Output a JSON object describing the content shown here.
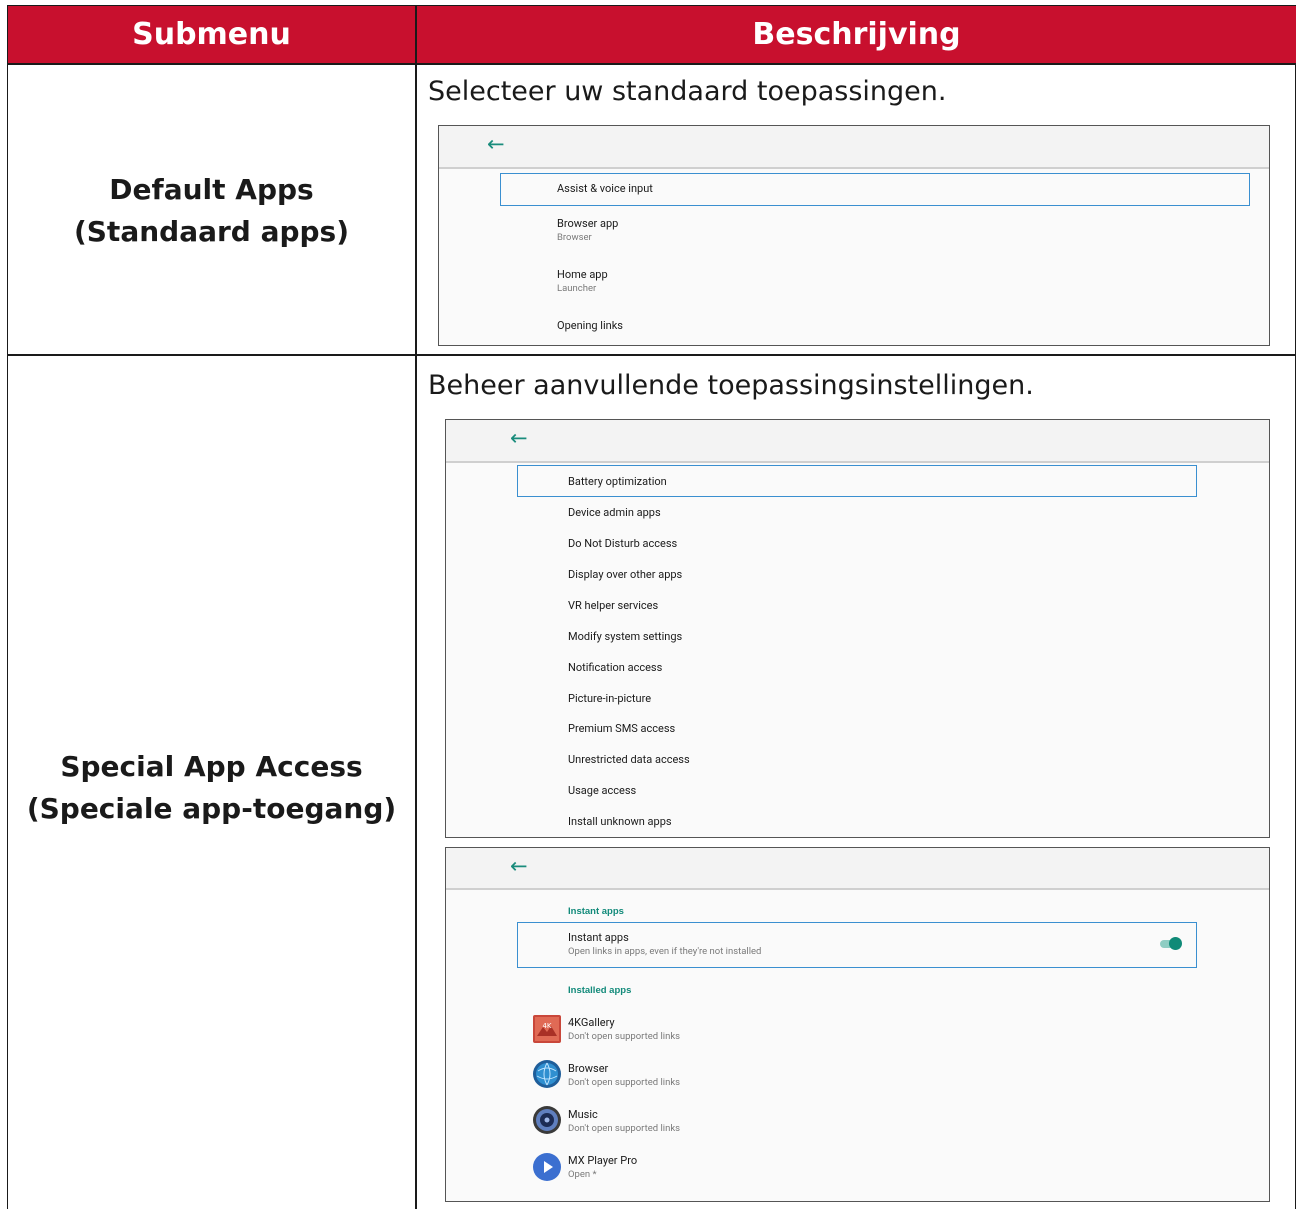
{
  "table": {
    "header": {
      "col1": "Submenu",
      "col2": "Beschrijving"
    },
    "rows": [
      {
        "label_line1": "Default Apps",
        "label_line2": "(Standaard apps)",
        "description": "Selecteer uw standaard toepassingen.",
        "screen": {
          "items": [
            {
              "title": "Assist & voice input",
              "subtitle": ""
            },
            {
              "title": "Browser app",
              "subtitle": "Browser"
            },
            {
              "title": "Home app",
              "subtitle": "Launcher"
            },
            {
              "title": "Opening links",
              "subtitle": ""
            }
          ]
        }
      },
      {
        "label_line1": "Special App Access",
        "label_line2": "(Speciale app-toegang)",
        "description": "Beheer aanvullende toepassingsinstellingen.",
        "screen1": {
          "items": [
            "Battery optimization",
            "Device admin apps",
            "Do Not Disturb access",
            "Display over other apps",
            "VR helper services",
            "Modify system settings",
            "Notification access",
            "Picture-in-picture",
            "Premium SMS access",
            "Unrestricted data access",
            "Usage access",
            "Install unknown apps"
          ]
        },
        "screen2": {
          "section_instant": "Instant apps",
          "instant_item": {
            "title": "Instant apps",
            "subtitle": "Open links in apps, even if they're not installed",
            "toggle_on": true
          },
          "section_installed": "Installed apps",
          "apps": [
            {
              "name": "4KGallery",
              "status": "Don't open supported links",
              "icon": "gallery-icon"
            },
            {
              "name": "Browser",
              "status": "Don't open supported links",
              "icon": "globe-icon"
            },
            {
              "name": "Music",
              "status": "Don't open supported links",
              "icon": "speaker-icon"
            },
            {
              "name": "MX Player Pro",
              "status": "Open *",
              "icon": "play-icon"
            }
          ]
        }
      }
    ]
  },
  "colors": {
    "header_bg": "#c8102e",
    "accent": "#0f8a77",
    "focus": "#3a8fd0"
  }
}
